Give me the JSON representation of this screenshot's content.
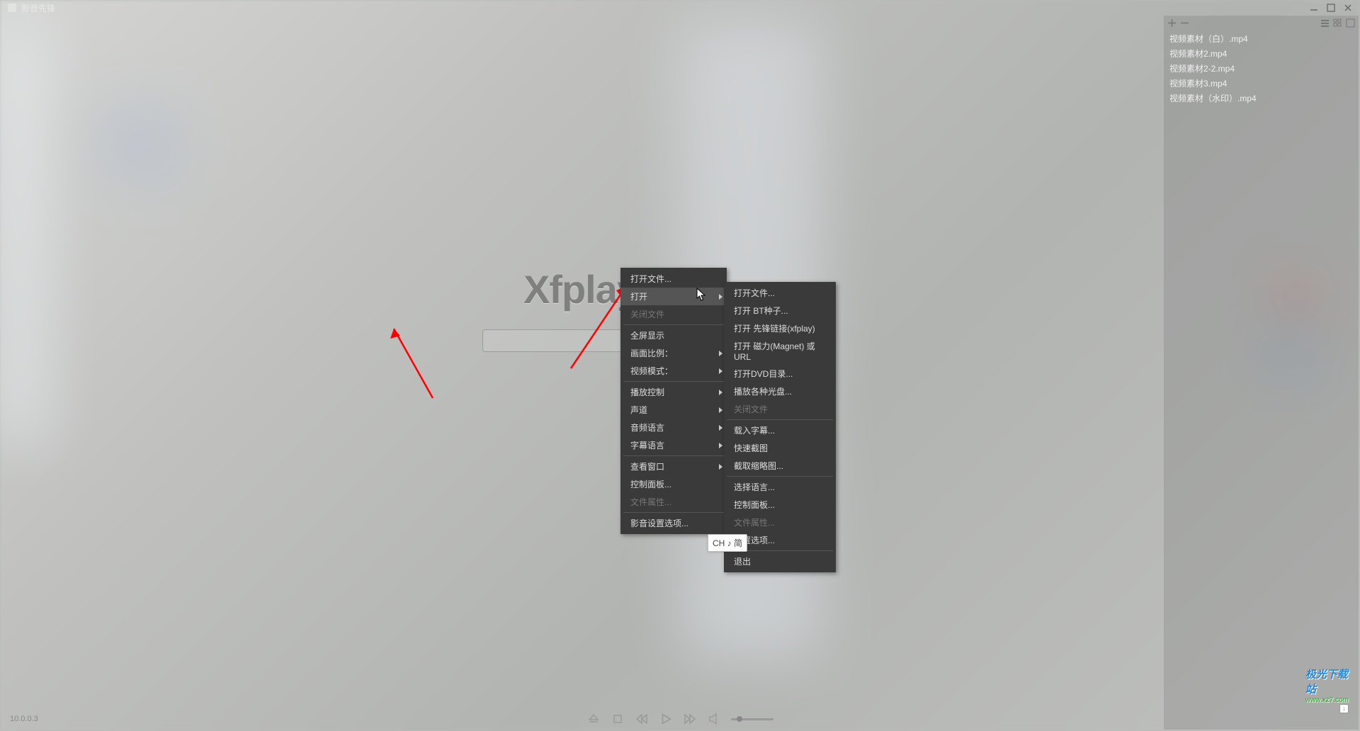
{
  "window": {
    "title": "影音先锋"
  },
  "logo": {
    "text": "Xfplay"
  },
  "search": {
    "placeholder": ""
  },
  "version": "10.0.0.3",
  "contextMenu1": {
    "items": [
      {
        "label": "打开文件...",
        "submenu": false,
        "disabled": false
      },
      {
        "label": "打开",
        "submenu": true,
        "disabled": false,
        "hover": true
      },
      {
        "label": "关闭文件",
        "submenu": false,
        "disabled": true
      },
      {
        "sep": true
      },
      {
        "label": "全屏显示",
        "submenu": false
      },
      {
        "label": "画面比例：",
        "submenu": true
      },
      {
        "label": "视频模式：",
        "submenu": true
      },
      {
        "sep": true
      },
      {
        "label": "播放控制",
        "submenu": true
      },
      {
        "label": "声道",
        "submenu": true
      },
      {
        "label": "音频语言",
        "submenu": true
      },
      {
        "label": "字幕语言",
        "submenu": true
      },
      {
        "sep": true
      },
      {
        "label": "查看窗口",
        "submenu": true
      },
      {
        "label": "控制面板...",
        "submenu": false
      },
      {
        "label": "文件属性...",
        "submenu": false,
        "disabled": true
      },
      {
        "sep": true
      },
      {
        "label": "影音设置选项...",
        "submenu": false
      }
    ]
  },
  "contextMenu2": {
    "items": [
      {
        "label": "打开文件..."
      },
      {
        "label": "打开 BT种子..."
      },
      {
        "label": "打开 先锋链接(xfplay)"
      },
      {
        "label": "打开 磁力(Magnet) 或 URL"
      },
      {
        "label": "打开DVD目录..."
      },
      {
        "label": "播放各种光盘..."
      },
      {
        "label": "关闭文件",
        "disabled": true
      },
      {
        "sep": true
      },
      {
        "label": "载入字幕..."
      },
      {
        "label": "快速截图"
      },
      {
        "label": "截取缩略图..."
      },
      {
        "sep": true
      },
      {
        "label": "选择语言..."
      },
      {
        "label": "控制面板..."
      },
      {
        "label": "文件属性...",
        "disabled": true
      },
      {
        "label": "设置选项..."
      },
      {
        "sep": true
      },
      {
        "label": "退出"
      }
    ]
  },
  "playlist": {
    "items": [
      "视频素材（白）.mp4",
      "视频素材2.mp4",
      "视频素材2-2.mp4",
      "视频素材3.mp4",
      "视频素材（水印）.mp4"
    ]
  },
  "ime": {
    "text": "CH ♪ 简"
  },
  "watermark": {
    "main": "极光下载站",
    "sub": "www.xz7.com",
    "badge": "↓"
  }
}
